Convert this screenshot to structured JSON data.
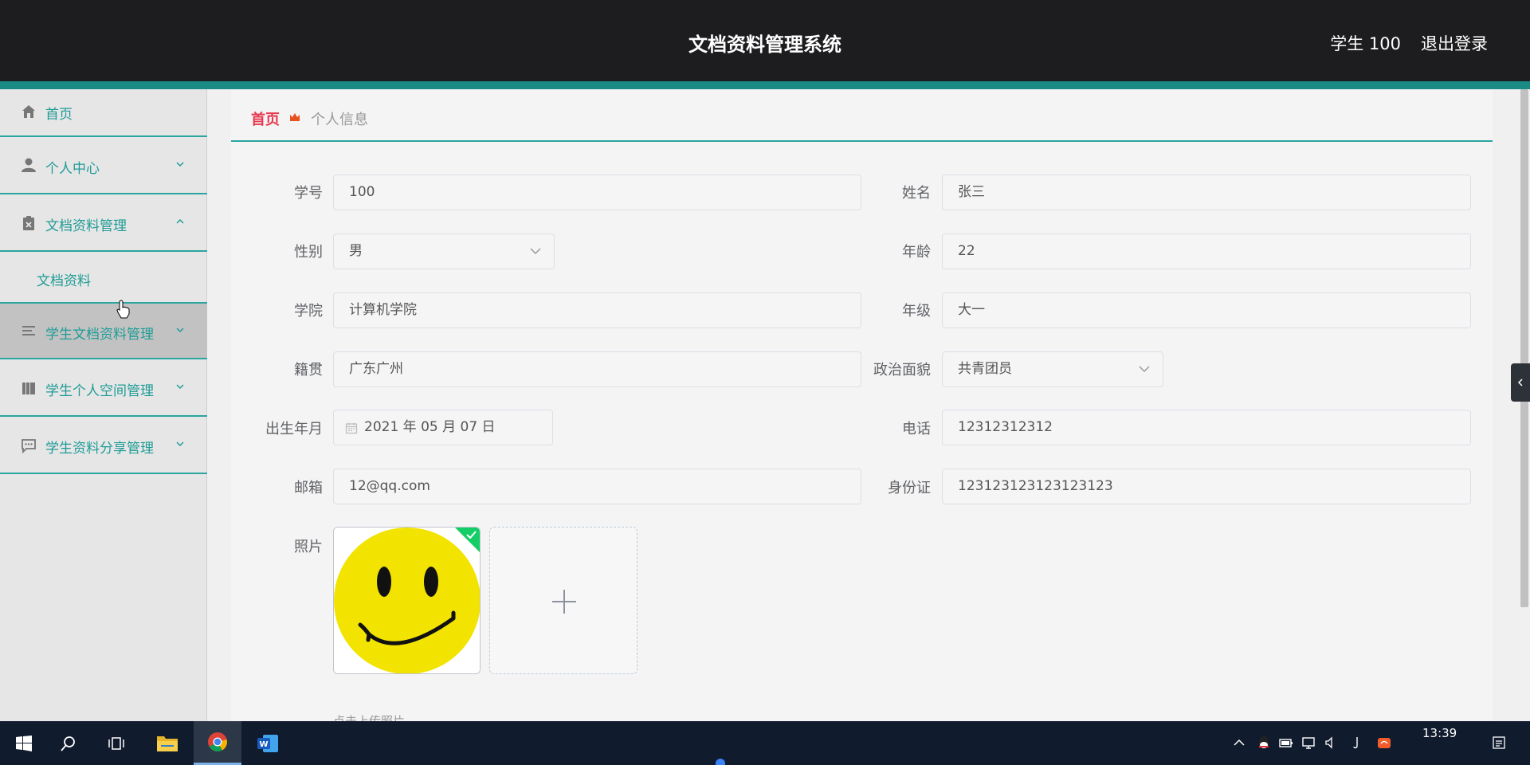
{
  "header": {
    "title": "文档资料管理系统",
    "user": "学生 100",
    "logout": "退出登录"
  },
  "sidebar": {
    "items": [
      {
        "label": "首页",
        "icon": "home-icon"
      },
      {
        "label": "个人中心",
        "icon": "user-icon"
      },
      {
        "label": "文档资料管理",
        "icon": "clipboard-icon"
      },
      {
        "label": "文档资料"
      },
      {
        "label": "学生文档资料管理",
        "icon": "list-icon"
      },
      {
        "label": "学生个人空间管理",
        "icon": "book-icon"
      },
      {
        "label": "学生资料分享管理",
        "icon": "chat-icon"
      }
    ]
  },
  "breadcrumb": {
    "home": "首页",
    "current": "个人信息"
  },
  "form": {
    "student_id": {
      "label": "学号",
      "value": "100"
    },
    "name": {
      "label": "姓名",
      "value": "张三"
    },
    "gender": {
      "label": "性别",
      "value": "男"
    },
    "age": {
      "label": "年龄",
      "value": "22"
    },
    "college": {
      "label": "学院",
      "value": "计算机学院"
    },
    "grade": {
      "label": "年级",
      "value": "大一"
    },
    "hometown": {
      "label": "籍贯",
      "value": "广东广州"
    },
    "political_status": {
      "label": "政治面貌",
      "value": "共青团员"
    },
    "birth_date": {
      "label": "出生年月",
      "value": "2021 年 05 月 07 日"
    },
    "phone": {
      "label": "电话",
      "value": "12312312312"
    },
    "email": {
      "label": "邮箱",
      "value": "12@qq.com"
    },
    "id_card": {
      "label": "身份证",
      "value": "123123123123123123"
    },
    "photo": {
      "label": "照片",
      "hint": "点击上传照片"
    }
  },
  "taskbar": {
    "clock": "13:39"
  },
  "colors": {
    "accent": "#1f9c96",
    "header_bg": "#1d1d1f",
    "breadcrumb_home": "#e8384f"
  }
}
